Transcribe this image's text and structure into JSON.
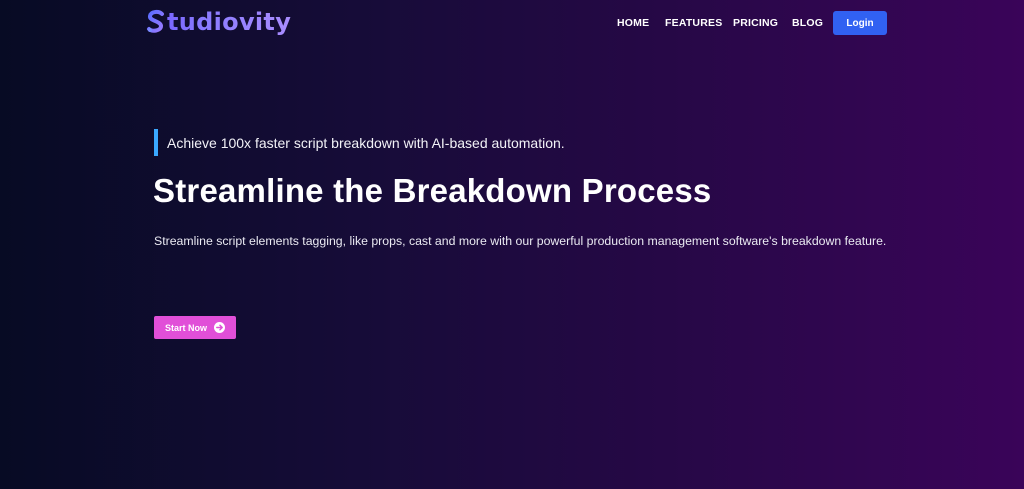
{
  "brand": {
    "name": "tudiovity",
    "logo_icon": "s-letter-logo-icon"
  },
  "nav": {
    "items": [
      {
        "label": "HOME"
      },
      {
        "label": "FEATURES"
      },
      {
        "label": "PRICING"
      },
      {
        "label": "BLOG"
      }
    ],
    "login_label": "Login"
  },
  "hero": {
    "tagline": "Achieve 100x faster script breakdown with AI-based automation.",
    "headline": "Streamline the Breakdown Process",
    "description": "Streamline script elements tagging, like props, cast and more with our powerful production management software's breakdown feature.",
    "cta_label": "Start Now",
    "cta_icon": "arrow-right-circle-icon"
  },
  "colors": {
    "accent_blue": "#3161f2",
    "tagline_bar": "#3aa8ff",
    "cta_pink": "#e14fd8",
    "background_start": "#070b24",
    "background_end": "#3a0459"
  }
}
